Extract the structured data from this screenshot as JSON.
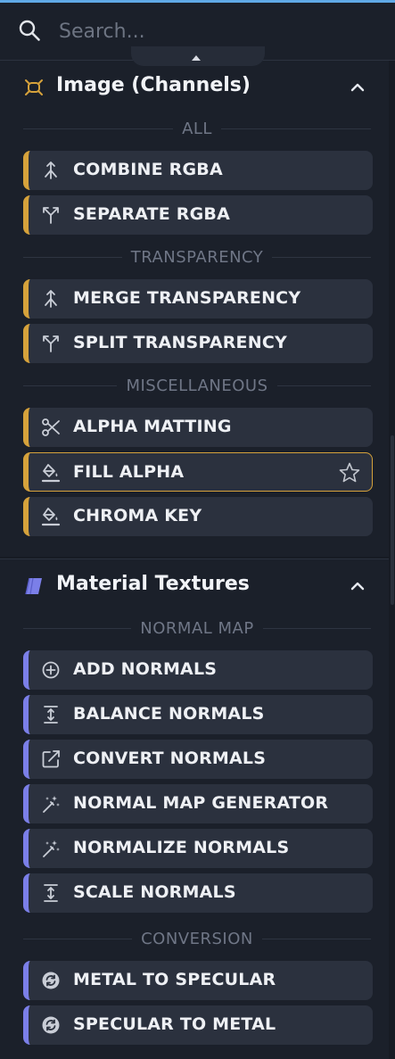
{
  "search": {
    "placeholder": "Search..."
  },
  "sections": [
    {
      "title": "Image (Channels)",
      "icon": "image-channels-icon",
      "accent": "#d6a23b",
      "groups": [
        {
          "label": "ALL",
          "items": [
            {
              "label": "COMBINE RGBA",
              "icon": "merge-arrows-icon"
            },
            {
              "label": "SEPARATE RGBA",
              "icon": "split-arrows-icon"
            }
          ]
        },
        {
          "label": "TRANSPARENCY",
          "items": [
            {
              "label": "MERGE TRANSPARENCY",
              "icon": "merge-arrows-icon"
            },
            {
              "label": "SPLIT TRANSPARENCY",
              "icon": "split-arrows-icon"
            }
          ]
        },
        {
          "label": "MISCELLANEOUS",
          "items": [
            {
              "label": "ALPHA MATTING",
              "icon": "scissors-icon"
            },
            {
              "label": "FILL ALPHA",
              "icon": "paint-bucket-icon",
              "selected": true,
              "favorite_icon": "star-outline-icon"
            },
            {
              "label": "CHROMA KEY",
              "icon": "paint-bucket-icon"
            }
          ]
        }
      ]
    },
    {
      "title": "Material Textures",
      "icon": "material-textures-icon",
      "accent": "#7b7fe8",
      "groups": [
        {
          "label": "NORMAL MAP",
          "items": [
            {
              "label": "ADD NORMALS",
              "icon": "plus-circle-icon"
            },
            {
              "label": "BALANCE NORMALS",
              "icon": "vertical-scale-icon"
            },
            {
              "label": "CONVERT NORMALS",
              "icon": "external-link-icon"
            },
            {
              "label": "NORMAL MAP GENERATOR",
              "icon": "magic-wand-icon"
            },
            {
              "label": "NORMALIZE NORMALS",
              "icon": "magic-wand-icon"
            },
            {
              "label": "SCALE NORMALS",
              "icon": "vertical-scale-icon"
            }
          ]
        },
        {
          "label": "CONVERSION",
          "items": [
            {
              "label": "METAL TO SPECULAR",
              "icon": "convert-circle-icon"
            },
            {
              "label": "SPECULAR TO METAL",
              "icon": "convert-circle-icon"
            }
          ]
        }
      ]
    }
  ],
  "colors": {
    "accent_image": "#d6a23b",
    "accent_material": "#7b7fe8",
    "top_highlight": "#60a9e6"
  }
}
